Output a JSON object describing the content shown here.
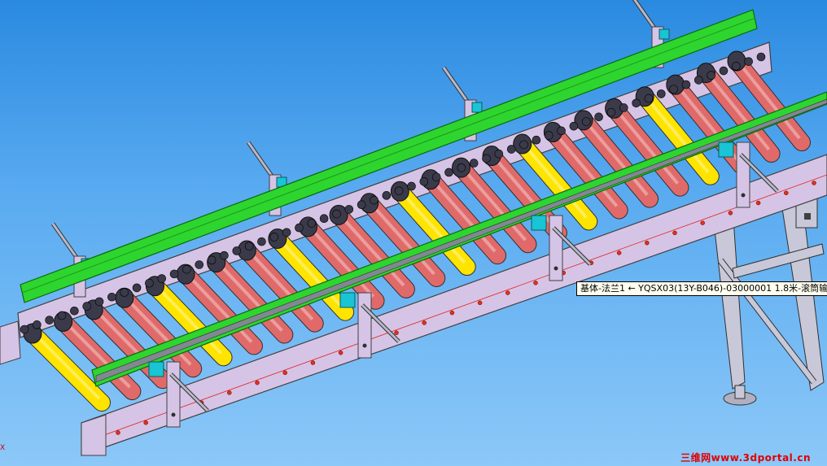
{
  "viewport": {
    "background_top": "#2a8ae0",
    "background_bottom": "#8cc8f8"
  },
  "model": {
    "roller_pattern": [
      "yellow",
      "red",
      "red",
      "red",
      "yellow",
      "red",
      "red",
      "red",
      "yellow",
      "red",
      "red",
      "red",
      "yellow",
      "red",
      "red",
      "red",
      "yellow",
      "red",
      "red",
      "red",
      "yellow",
      "red",
      "red",
      "red"
    ],
    "colors": {
      "roller_red": "#e06a6a",
      "roller_yellow": "#ffe400",
      "guide_rail": "#2ed52e",
      "frame": "#d6c4e6",
      "frame_edge": "#404040",
      "chain": "#3a3a4a",
      "clamp": "#19c4d4",
      "hole": "#e0301c"
    }
  },
  "tooltip": {
    "text": "基体-法兰1 ← YQSX03(13Y-B046)-03000001 1.8米-滚筒输"
  },
  "watermark": {
    "text": "三维网www.3dportal.cn"
  },
  "axis_indicator": {
    "label": "X"
  }
}
